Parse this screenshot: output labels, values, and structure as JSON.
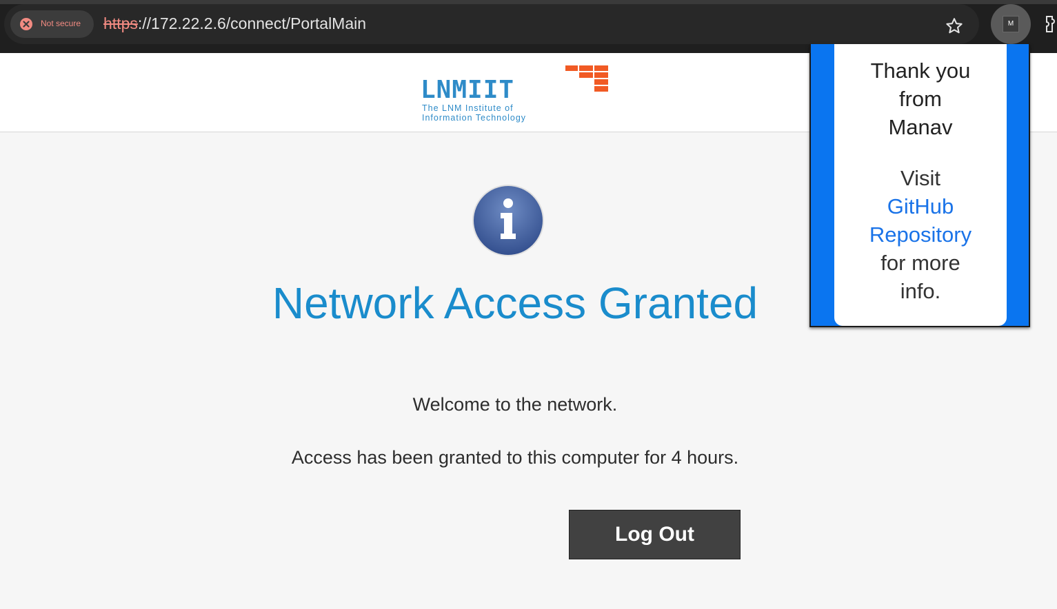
{
  "browser": {
    "security_label": "Not secure",
    "url_scheme": "https",
    "url_rest": "://172.22.2.6/connect/PortalMain",
    "profile_initial": "M"
  },
  "logo": {
    "name": "LNMIIT",
    "line1": "The LNM Institute of",
    "line2": "Information Technology"
  },
  "main": {
    "title": "Network Access Granted",
    "welcome": "Welcome to the network.",
    "access": "Access has been granted to this computer for 4 hours.",
    "logout_label": "Log Out"
  },
  "popup": {
    "thanks_line1": "Thank you",
    "thanks_line2": "from",
    "thanks_line3": "Manav",
    "visit": "Visit",
    "link_line1": "GitHub",
    "link_line2": "Repository",
    "more_line1": "for more",
    "more_line2": "info."
  },
  "colors": {
    "title": "#1a8ccc",
    "popup_accent": "#0a75f0",
    "logo_blue": "#2e8bc8",
    "logo_orange": "#f15a24"
  }
}
